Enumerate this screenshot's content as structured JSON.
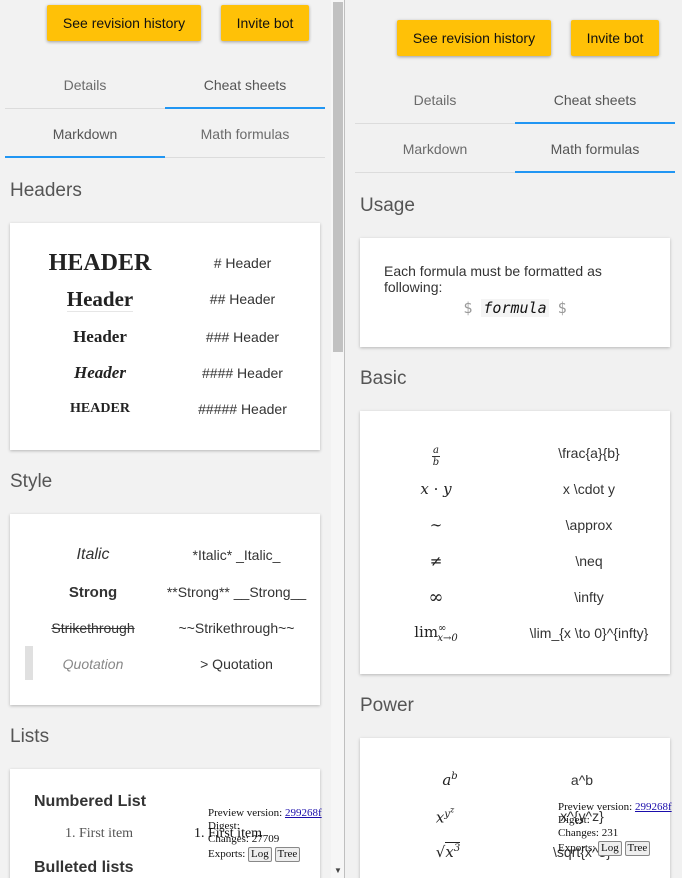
{
  "left": {
    "buttons": {
      "revision": "See revision history",
      "invite": "Invite bot"
    },
    "tabs1": [
      "Details",
      "Cheat sheets"
    ],
    "tabs2": [
      "Markdown",
      "Math formulas"
    ],
    "headers": {
      "title": "Headers",
      "rows": [
        {
          "label": "HEADER",
          "syntax": "# Header"
        },
        {
          "label": "Header",
          "syntax": "## Header"
        },
        {
          "label": "Header",
          "syntax": "### Header"
        },
        {
          "label": "Header",
          "syntax": "#### Header"
        },
        {
          "label": "HEADER",
          "syntax": "##### Header"
        }
      ]
    },
    "style": {
      "title": "Style",
      "rows": [
        {
          "label": "Italic",
          "syntax": "*Italic* _Italic_"
        },
        {
          "label": "Strong",
          "syntax": "**Strong** __Strong__"
        },
        {
          "label": "Strikethrough",
          "syntax": "~~Strikethrough~~"
        },
        {
          "label": "Quotation",
          "syntax": "> Quotation"
        }
      ]
    },
    "lists": {
      "title": "Lists",
      "numbered_title": "Numbered List",
      "numbered_item_rendered": "1. First item",
      "numbered_item_syntax": "1. First item",
      "bulleted_title": "Bulleted lists"
    },
    "preview": {
      "version_label": "Preview version:",
      "version_link": "299268f",
      "digest_label": "Digest:",
      "changes_label": "Changes:",
      "changes_value": "27709",
      "exports_label": "Exports:",
      "log_btn": "Log",
      "tree_btn": "Tree"
    }
  },
  "right": {
    "buttons": {
      "revision": "See revision history",
      "invite": "Invite bot"
    },
    "tabs1": [
      "Details",
      "Cheat sheets"
    ],
    "tabs2": [
      "Markdown",
      "Math formulas"
    ],
    "usage": {
      "title": "Usage",
      "text": "Each formula must be formatted as following:",
      "dollar": "$",
      "formula_word": "formula"
    },
    "basic": {
      "title": "Basic",
      "rows": [
        {
          "syntax": "\\frac{a}{b}"
        },
        {
          "syntax": "x \\cdot y"
        },
        {
          "syntax": "\\approx"
        },
        {
          "syntax": "\\neq"
        },
        {
          "syntax": "\\infty"
        },
        {
          "syntax": "\\lim_{x \\to 0}^{infty}"
        }
      ]
    },
    "power": {
      "title": "Power",
      "rows": [
        {
          "syntax": "a^b"
        },
        {
          "syntax": "x^{y^z}"
        },
        {
          "syntax": "\\sqrt{x^3}"
        }
      ]
    },
    "preview": {
      "version_label": "Preview version:",
      "version_link": "299268f",
      "digest_label": "Digest:",
      "changes_label": "Changes:",
      "changes_value": "231",
      "exports_label": "Exports:",
      "log_btn": "Log",
      "tree_btn": "Tree"
    }
  }
}
